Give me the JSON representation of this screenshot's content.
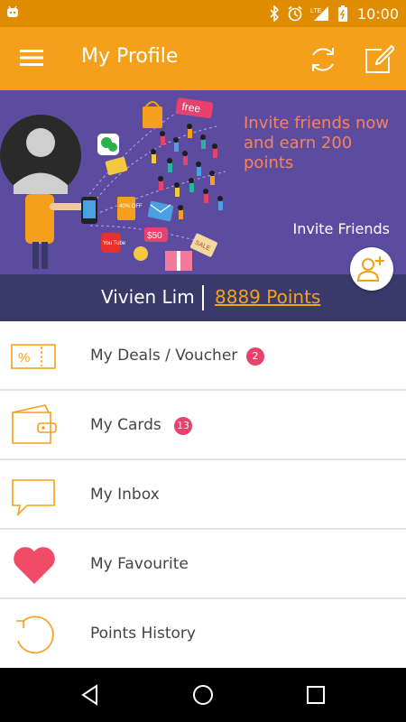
{
  "status_bar": {
    "network": "LTE",
    "time": "10:00"
  },
  "app_bar": {
    "title": "My Profile",
    "icons": [
      "menu-icon",
      "refresh-icon",
      "edit-icon"
    ]
  },
  "banner": {
    "invite_text": "Invite friends now and earn 200 points",
    "invite_link": "Invite Friends",
    "art_labels": {
      "free": "free",
      "sale": "SALE",
      "dollar": "$50",
      "discount": "40% OFF",
      "youtube": "You Tube"
    }
  },
  "profile": {
    "name": "Vivien Lim",
    "points": "8889 Points"
  },
  "menu": [
    {
      "label": "My Deals / Voucher",
      "badge": "2",
      "icon": "voucher-icon"
    },
    {
      "label": "My Cards",
      "badge": "13",
      "icon": "wallet-icon"
    },
    {
      "label": "My Inbox",
      "badge": "",
      "icon": "chat-bubble-icon"
    },
    {
      "label": "My Favourite",
      "badge": "",
      "icon": "heart-icon"
    },
    {
      "label": "Points History",
      "badge": "",
      "icon": "history-icon"
    }
  ],
  "colors": {
    "primary": "#f5a01a",
    "status_bar": "#e08c00",
    "banner_bg": "#5b4ca0",
    "name_bar": "#3a3a6a",
    "badge": "#e8416b",
    "heart": "#f04c68"
  }
}
